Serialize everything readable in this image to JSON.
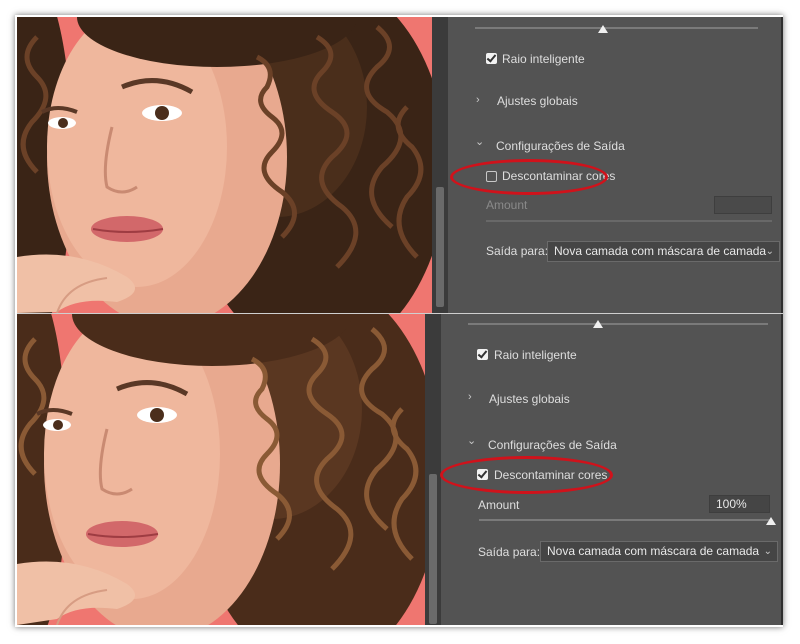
{
  "colors": {
    "panel_bg": "#535353",
    "photo_bg": "#ef7670",
    "highlight_ring": "#d0121b"
  },
  "top_panel": {
    "raio_inteligente": {
      "label": "Raio inteligente",
      "checked": true
    },
    "ajustes_globais": {
      "label": "Ajustes globais",
      "expanded": false
    },
    "configuracoes_saida": {
      "label": "Configurações de Saída",
      "expanded": true
    },
    "descontaminar": {
      "label": "Descontaminar cores",
      "checked": false
    },
    "amount": {
      "label": "Amount",
      "value": "",
      "enabled": false
    },
    "saida_para": {
      "label": "Saída para:",
      "value": "Nova camada com máscara de camada"
    }
  },
  "bottom_panel": {
    "raio_inteligente": {
      "label": "Raio inteligente",
      "checked": true
    },
    "ajustes_globais": {
      "label": "Ajustes globais",
      "expanded": false
    },
    "configuracoes_saida": {
      "label": "Configurações de Saída",
      "expanded": true
    },
    "descontaminar": {
      "label": "Descontaminar cores",
      "checked": true
    },
    "amount": {
      "label": "Amount",
      "value": "100%",
      "enabled": true
    },
    "saida_para": {
      "label": "Saída para:",
      "value": "Nova camada com máscara de camada"
    }
  },
  "icons": {
    "chevron_right": "›",
    "chevron_down": "⌄",
    "dropdown_arrow": "⌄"
  }
}
